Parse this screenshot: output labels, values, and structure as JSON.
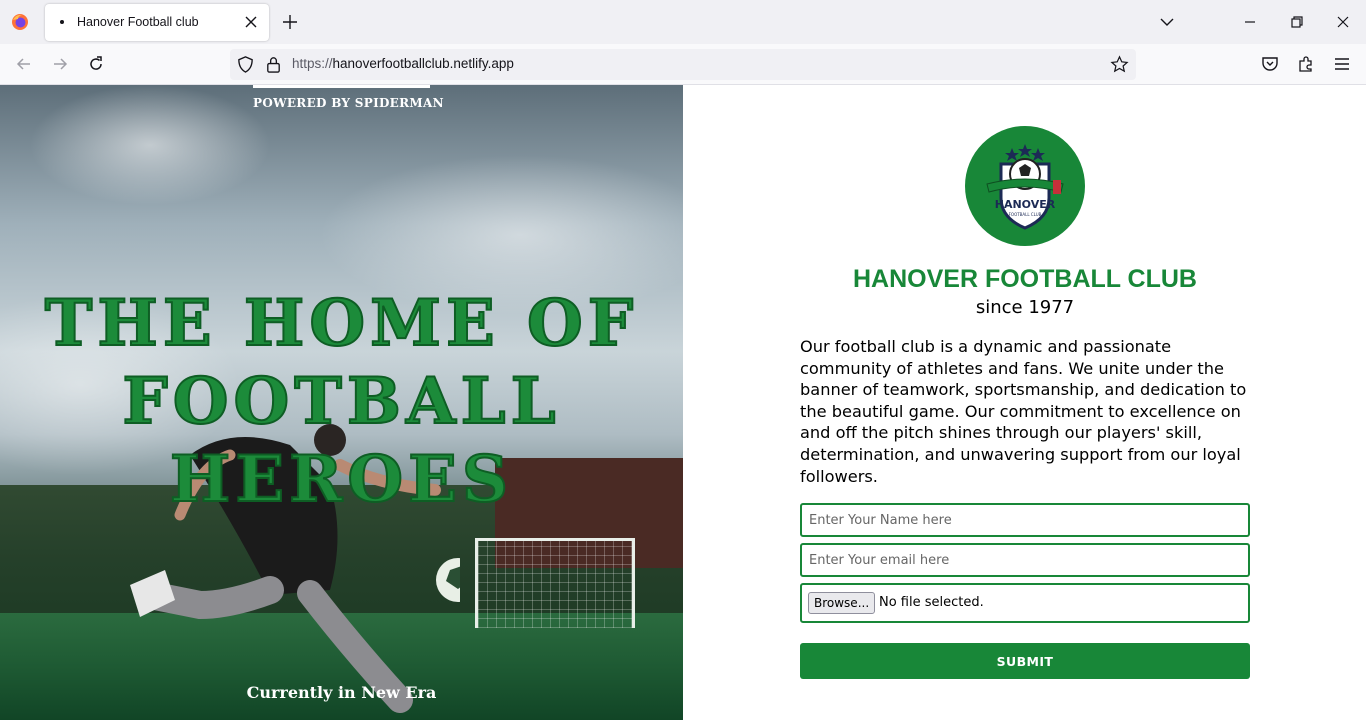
{
  "browser": {
    "tab_title": "Hanover Football club",
    "url_scheme": "https://",
    "url_host": "hanoverfootballclub.netlify.app"
  },
  "hero": {
    "powered_by": "POWERED BY SPIDERMAN",
    "title_lines": [
      "THE HOME OF",
      "FOOTBALL",
      "HEROES"
    ],
    "bottom_text": "Currently in New Era"
  },
  "club": {
    "logo_text": "HANOVER",
    "logo_subtext": "FOOTBALL CLUB",
    "name": "HANOVER FOOTBALL CLUB",
    "since": "since 1977",
    "about": "Our football club is a dynamic and passionate community of athletes and fans. We unite under the banner of teamwork, sportsmanship, and dedication to the beautiful game. Our commitment to excellence on and off the pitch shines through our players' skill, determination, and unwavering support from our loyal followers."
  },
  "form": {
    "name_placeholder": "Enter Your Name here",
    "email_placeholder": "Enter Your email here",
    "browse_label": "Browse...",
    "file_status": "No file selected.",
    "submit_label": "SUBMIT"
  },
  "colors": {
    "brand_green": "#188738",
    "hero_title_green": "#1c8b3a"
  }
}
